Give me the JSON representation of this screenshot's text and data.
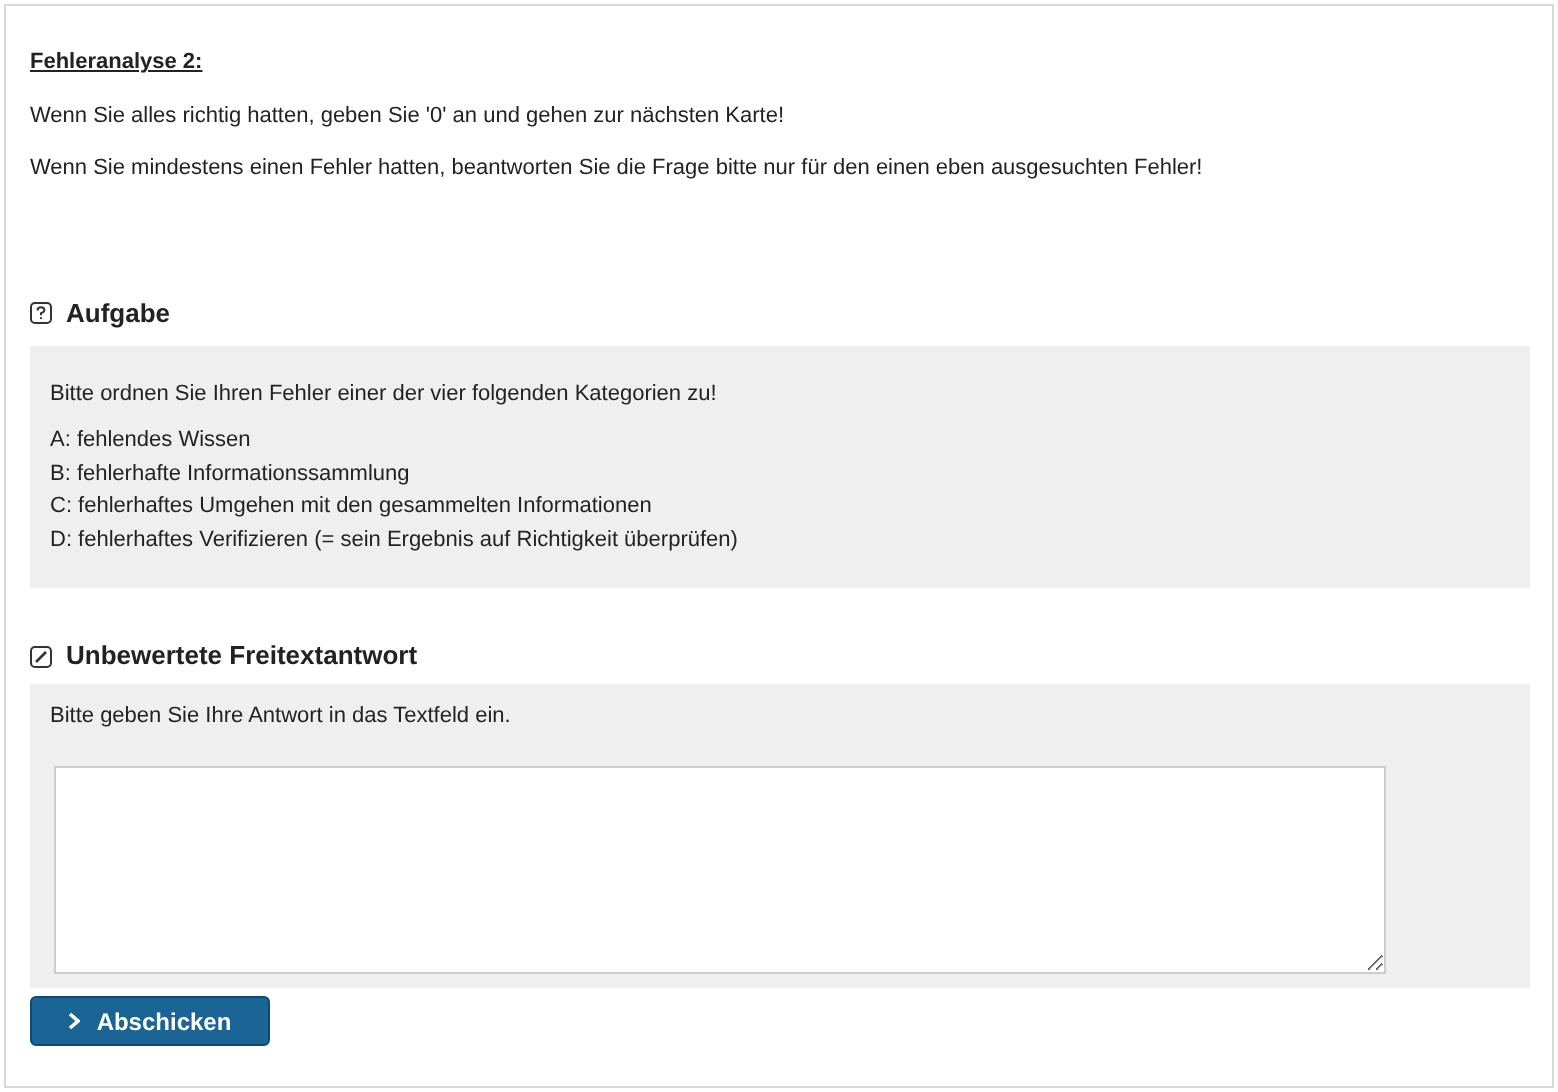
{
  "intro": {
    "title": "Fehleranalyse 2:",
    "lines": [
      "Wenn Sie alles richtig hatten, geben Sie '0' an und gehen zur nächsten Karte!",
      "Wenn Sie mindestens einen Fehler hatten, beantworten Sie die Frage bitte nur für den einen eben ausgesuchten Fehler!"
    ]
  },
  "task": {
    "heading": "Aufgabe",
    "prompt": "Bitte ordnen Sie Ihren Fehler einer der vier folgenden Kategorien zu!",
    "categories": [
      "A: fehlendes Wissen",
      "B: fehlerhafte Informationssammlung",
      "C: fehlerhaftes Umgehen mit den gesammelten Informationen",
      "D: fehlerhaftes Verifizieren (= sein Ergebnis auf Richtigkeit überprüfen)"
    ]
  },
  "answer": {
    "heading": "Unbewertete Freitextantwort",
    "instruction": "Bitte geben Sie Ihre Antwort in das Textfeld ein."
  },
  "submit": {
    "label": "Abschicken"
  }
}
